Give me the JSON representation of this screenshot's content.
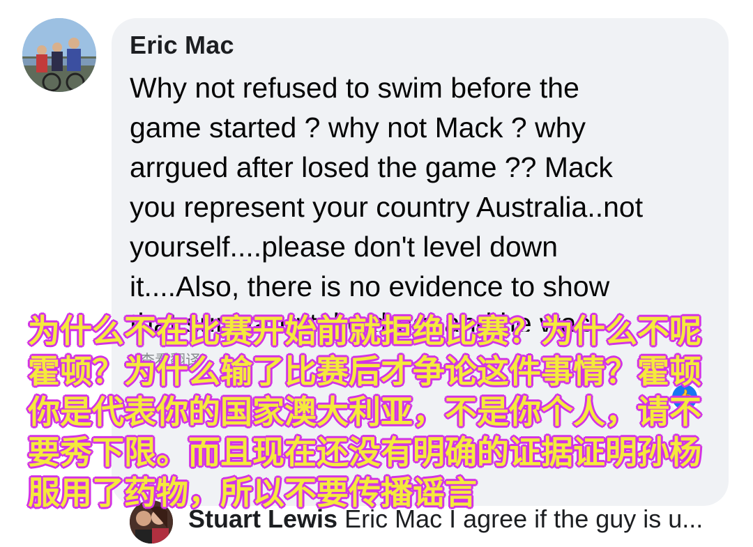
{
  "comment": {
    "author": "Eric Mac",
    "lines": [
      "Why not refused to swim before the",
      "game started ? why not Mack ? why",
      "arrgued after losed the game ?? Mack",
      "you represent your country Australia..not",
      "yourself....please don't level down",
      "it....Also, there is no evidence to show"
    ],
    "partial_line": "that sun yang take drug, and he was",
    "see_translation": "查看翻译",
    "reaction_icon": "like-icon"
  },
  "reply": {
    "author": "Stuart Lewis",
    "text": "Eric Mac I agree if the guy is u..."
  },
  "subtitle": {
    "text": "为什么不在比赛开始前就拒绝比赛？为什么不呢霍顿？为什么输了比赛后才争论这件事情？霍顿你是代表你的国家澳大利亚，不是你个人，请不要秀下限。而且现在还没有明确的证据证明孙杨服用了药物，所以不要传播谣言"
  },
  "colors": {
    "bubble": "#f0f2f5",
    "subtitle_fill": "#f5e93c",
    "subtitle_stroke": "#d233e6"
  }
}
